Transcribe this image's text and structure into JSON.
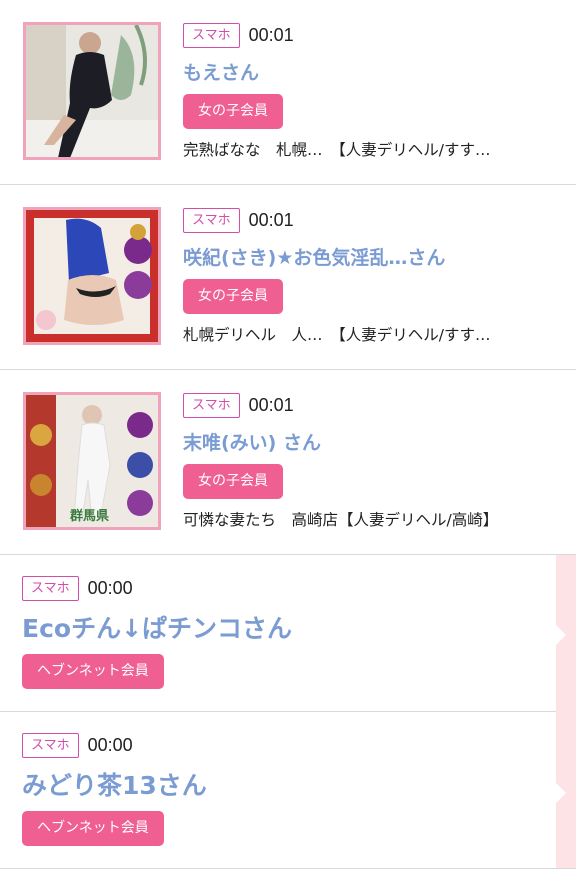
{
  "messages": [
    {
      "kind": "girl",
      "device_badge": "スマホ",
      "time": "00:01",
      "name": "もえさん",
      "member_badge": "女の子会員",
      "shop_1": "完熟ばなな　札幌…",
      "shop_2": "【人妻デリヘル/すす…"
    },
    {
      "kind": "girl",
      "device_badge": "スマホ",
      "time": "00:01",
      "name": "咲紀(さき)★お色気淫乱…さん",
      "member_badge": "女の子会員",
      "shop_1": "札幌デリヘル　人…",
      "shop_2": "【人妻デリヘル/すす…"
    },
    {
      "kind": "girl",
      "device_badge": "スマホ",
      "time": "00:01",
      "name": "末唯(みい) さん",
      "member_badge": "女の子会員",
      "shop_1": "可憐な妻たち　高崎店",
      "shop_2": "【人妻デリヘル/高崎】",
      "thumb_overlay_text": "群馬県"
    },
    {
      "kind": "user",
      "device_badge": "スマホ",
      "time": "00:00",
      "name": "Ecoチん↓ぱチンコさん",
      "member_badge": "ヘブンネット会員"
    },
    {
      "kind": "user",
      "device_badge": "スマホ",
      "time": "00:00",
      "name": "みどり茶13さん",
      "member_badge": "ヘブンネット会員"
    }
  ],
  "colors": {
    "device_badge": "#d24ea8",
    "name": "#7a9cd3",
    "member_badge_bg": "#f05f92",
    "thumb_border": "#f0a3ba",
    "strip": "#fde3e6"
  }
}
